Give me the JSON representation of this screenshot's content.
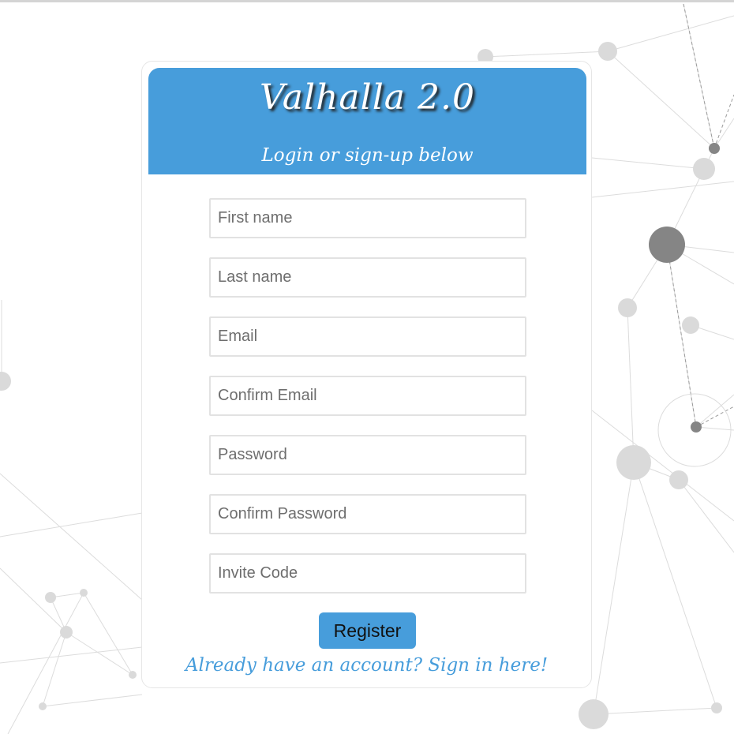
{
  "header": {
    "title": "Valhalla 2.0",
    "subtitle": "Login or sign-up below"
  },
  "form": {
    "fields": [
      {
        "placeholder": "First name",
        "value": ""
      },
      {
        "placeholder": "Last name",
        "value": ""
      },
      {
        "placeholder": "Email",
        "value": ""
      },
      {
        "placeholder": "Confirm Email",
        "value": ""
      },
      {
        "placeholder": "Password",
        "value": ""
      },
      {
        "placeholder": "Confirm Password",
        "value": ""
      },
      {
        "placeholder": "Invite Code",
        "value": ""
      }
    ],
    "register_label": "Register",
    "signin_link": "Already have an account? Sign in here!"
  },
  "colors": {
    "accent": "#479ddb",
    "background": "#ffffff",
    "network_nodes": "#d9d9d9",
    "network_nodes_dark": "#858585"
  },
  "background": {
    "decoration": "network-graph"
  }
}
